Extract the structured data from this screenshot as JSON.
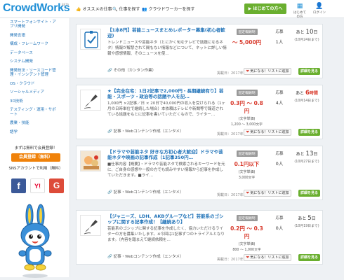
{
  "header": {
    "logo": "CrowdWorks",
    "logo_beta": "BETA",
    "nav": [
      {
        "label": "オススメの仕事"
      },
      {
        "label": "仕事を探す"
      },
      {
        "label": "クラウドワーカーを探す"
      }
    ],
    "cta": "はじめての方へ",
    "icons": [
      {
        "label": "はじめての方"
      },
      {
        "label": "ログイン"
      }
    ]
  },
  "sidebar": {
    "items": [
      "スマートフォンサイト・アプリ開発",
      "開発言語",
      "構成・フレームワーク",
      "データベース",
      "システム開発",
      "開発技法・ソースコード管理・インシデント管理",
      "OS・クラウド",
      "ソーシャルメディア",
      "3D技術",
      "テスティング・運用・サポート",
      "農業・技能",
      "語学"
    ],
    "register": {
      "text": "まずは無料で会員登録！",
      "button": "会員登録（無料）",
      "sns_text": "SNSアカウントで利用（無料）"
    },
    "socials": [
      {
        "label": "f",
        "color": "#3b5998"
      },
      {
        "label": "Y!",
        "color": "#ffffff",
        "text_color": "#e6002d"
      },
      {
        "label": "G",
        "color": "#dd4b39"
      }
    ]
  },
  "jobs": [
    {
      "title": "【1本8円】芸能ニュースまとめレポーター募集(初心者歓迎)",
      "desc": "トレンドニュースや芸能ネタ（とにかく旬なテレビで話題になるネタ）情報が解禁されて間もない情報などについて、ネットに詳しい情報や感想情報、そのニュースを使…",
      "category": "その他（カンタン作業）",
      "date": "掲載日：2017年10月10日",
      "badge": "固定報酬制",
      "price": "～ 5,000円",
      "price_unit": "",
      "price_sub": "",
      "applicants_label": "応募",
      "applicants": "1人",
      "deadline_prefix": "あと",
      "deadline": "10",
      "deadline_unit": "日",
      "deadline_date": "(10月24日まで)",
      "deadline_urgent": false,
      "fav": "気になる！リストに追加",
      "detail": "詳細を見る",
      "thumb": "doc"
    },
    {
      "title": "★【完全在宅：1日2記事で2,000円・長期継続有り】芸能・スポーツ・政治等の話題や人を記…",
      "desc": "1,000円 ×2記事／日 × 20日で40,000円の収入を受けられる（1ヶ月の日時単位で継続した場合）本依頼はテレビや新聞等で報道されている話題をもとに記事を書いていただくもので、ライター…",
      "category": "記事・Webコンテンツ作成（エンタメ）",
      "date": "掲載日：2017年10月10日",
      "badge": "固定報酬制",
      "price": "0.3円 ～ 0.8円",
      "price_unit": "(文字単価)",
      "price_sub": "1,200 ～ 3,000文字",
      "applicants_label": "応募",
      "applicants": "4人",
      "deadline_prefix": "あと",
      "deadline": "6",
      "deadline_unit": "時間",
      "deadline_date": "(10月14日まで)",
      "deadline_urgent": true,
      "fav": "気になる！リストに追加",
      "detail": "詳細を見る",
      "thumb": "pen"
    },
    {
      "title": "【ドラマや芸能ネタ 好きな方初心者大歓迎】ドラマや芸能ネタや映画の記事作成（1記事350円…",
      "desc": "■仕事内容【概要】・ドラマや芸能ネタで検索されるキーワードを元に、ご自身の感想や一般の方でも読みやすい情報から記事を作成していただきます。■ライ…",
      "category": "記事・Webコンテンツ作成（エンタメ）",
      "date": "掲載日：2017年10月13日",
      "badge": "固定報酬制",
      "price": "0.1円以下",
      "price_unit": "(文字単価)",
      "price_sub": "3,000文字",
      "applicants_label": "応募",
      "applicants": "0人",
      "deadline_prefix": "あと",
      "deadline": "13",
      "deadline_unit": "日",
      "deadline_date": "(10月27日まで)",
      "deadline_urgent": false,
      "fav": "気になる！リストに追加",
      "detail": "詳細を見る",
      "thumb": "photo"
    },
    {
      "title": "【ジャニーズ、LDH、AKBグループなど】芸能系のゴシップに関する記事作成！【継続あり】",
      "desc": "芸能系のゴシップに関する記事を作成したく、協力いただけるライターの方を募集いたします。※今回は1記事ずつのトライアルとなります。（内容を踏まえて継続依頼を…",
      "category": "記事・Webコンテンツ作成（エンタメ）",
      "date": "掲載日：2017年10月05日",
      "badge": "固定報酬制",
      "price": "0.2円 ～ 0.3円",
      "price_unit": "(文字単価)",
      "price_sub": "800 ～ 1,000文字",
      "applicants_label": "応募",
      "applicants": "0人",
      "deadline_prefix": "あと",
      "deadline": "5",
      "deadline_unit": "日",
      "deadline_date": "(10月19日まで)",
      "deadline_urgent": false,
      "fav": "気になる！リストに追加",
      "detail": "詳細を見る",
      "thumb": "pen"
    }
  ]
}
